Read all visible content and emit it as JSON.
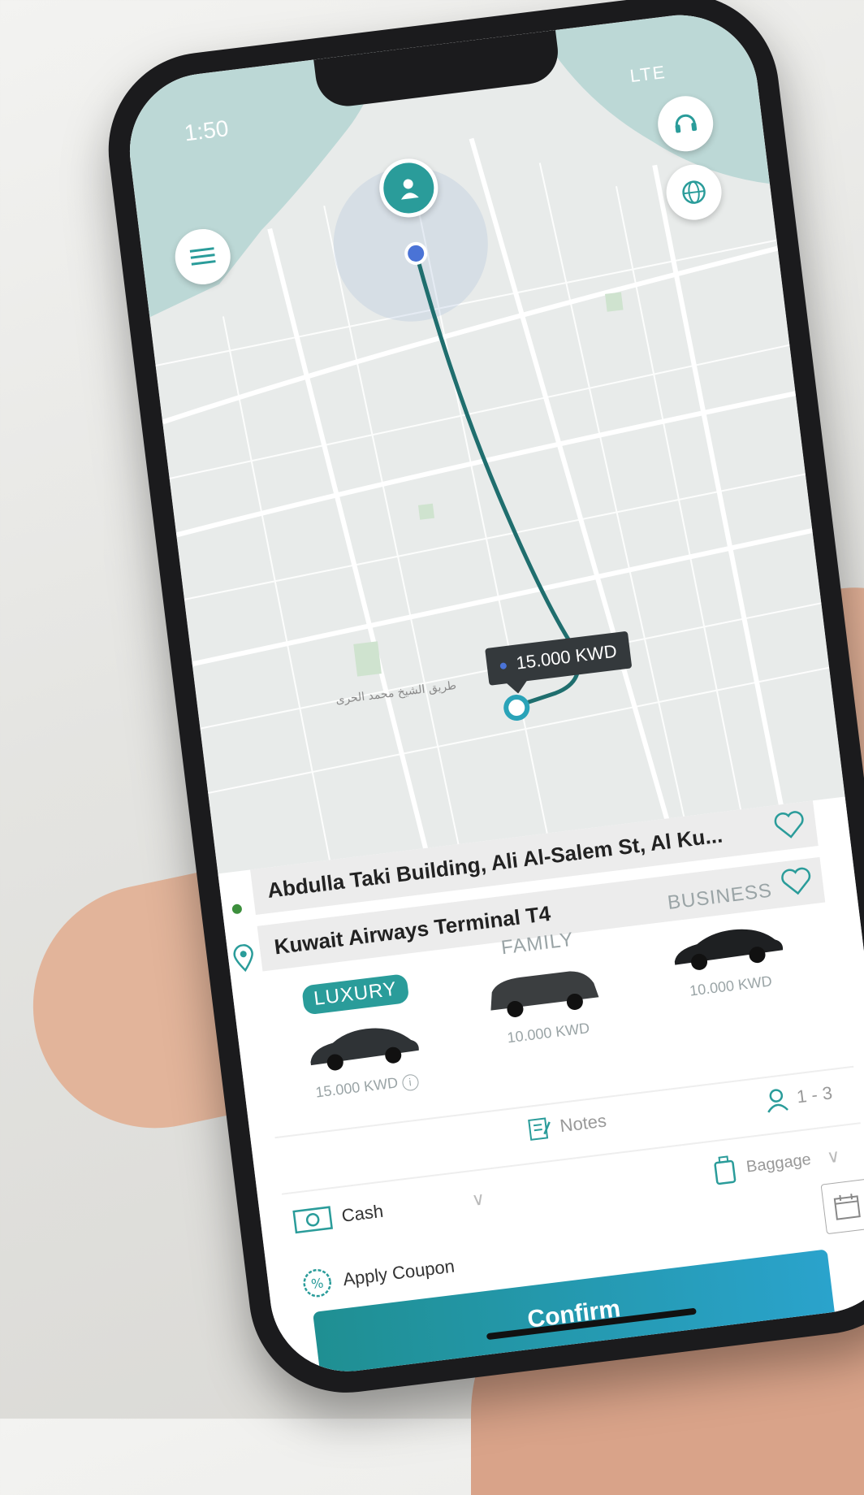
{
  "status": {
    "time": "1:50",
    "network": "LTE"
  },
  "map": {
    "fare_label": "15.000 KWD",
    "street_label": "طريق الشيخ محمد الحرى"
  },
  "route": {
    "pickup": "Abdulla Taki Building, Ali Al-Salem St, Al Ku...",
    "dropoff": "Kuwait Airways Terminal T4"
  },
  "vehicles": [
    {
      "name": "LUXURY",
      "price": "15.000 KWD",
      "selected": true
    },
    {
      "name": "FAMILY",
      "price": "10.000 KWD",
      "selected": false
    },
    {
      "name": "BUSINESS",
      "price": "10.000 KWD",
      "selected": false
    }
  ],
  "options": {
    "notes": "Notes",
    "passengers": "1 - 3",
    "payment": "Cash",
    "baggage": "Baggage",
    "coupon": "Apply Coupon"
  },
  "confirm_label": "Confirm",
  "colors": {
    "accent": "#2a9c9a",
    "route": "#1f6e6e",
    "map_water": "#bcd8d6",
    "map_land": "#e8ebea"
  }
}
